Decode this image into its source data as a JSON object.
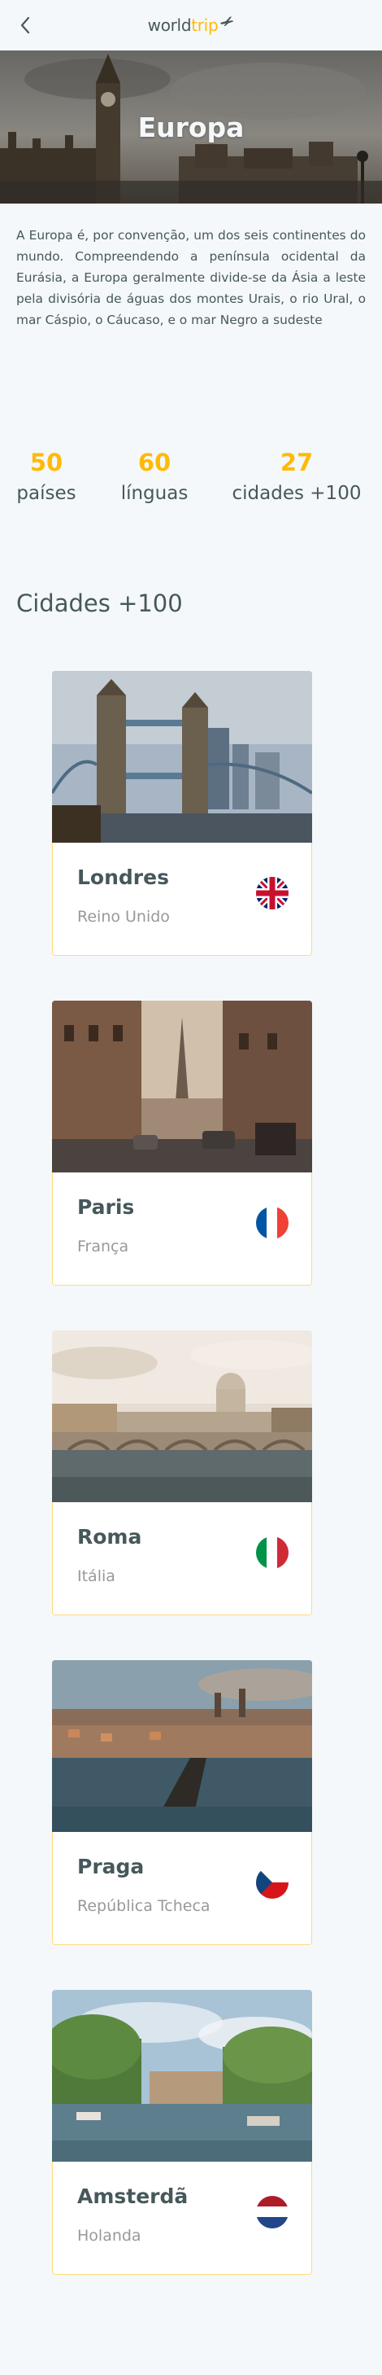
{
  "header": {
    "logo_part1": "world",
    "logo_part2": "trip"
  },
  "banner": {
    "title": "Europa"
  },
  "description": "A Europa é, por convenção, um dos seis continentes do mundo. Compreendendo a península ocidental da Eurásia, a Europa geralmente divide-se da Ásia a leste pela divisória de águas dos montes Urais, o rio Ural, o mar Cáspio, o Cáucaso, e o mar Negro a sudeste",
  "stats": [
    {
      "value": "50",
      "label": "países"
    },
    {
      "value": "60",
      "label": "línguas"
    },
    {
      "value": "27",
      "label": "cidades +100"
    }
  ],
  "section_title": "Cidades +100",
  "cities": [
    {
      "name": "Londres",
      "country": "Reino Unido"
    },
    {
      "name": "Paris",
      "country": "França"
    },
    {
      "name": "Roma",
      "country": "Itália"
    },
    {
      "name": "Praga",
      "country": "República Tcheca"
    },
    {
      "name": "Amsterdã",
      "country": "Holanda"
    }
  ],
  "colors": {
    "accent": "#FFBA08",
    "text": "#47585B",
    "muted": "#999999",
    "background": "#F5F8FA"
  }
}
